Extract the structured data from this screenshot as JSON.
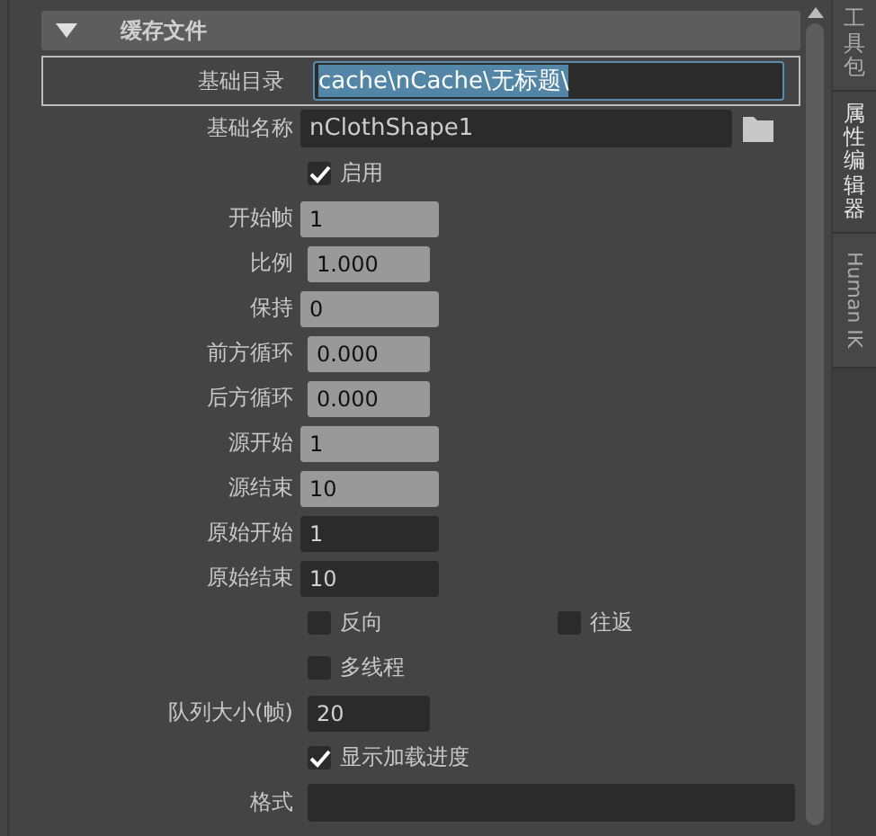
{
  "section": {
    "title": "缓存文件",
    "expanded": true
  },
  "base_dir": {
    "label": "基础目录",
    "value": "cache\\nCache\\无标题\\",
    "focused": true
  },
  "base_name": {
    "label": "基础名称",
    "value": "nClothShape1"
  },
  "rows": [
    {
      "kind": "checkbox",
      "label": "启用",
      "checked": true
    },
    {
      "kind": "int_field",
      "label": "开始帧",
      "value": "1",
      "editable": true
    },
    {
      "kind": "float_field",
      "label": "比例",
      "value": "1.000",
      "editable": true
    },
    {
      "kind": "int_field",
      "label": "保持",
      "value": "0",
      "editable": true
    },
    {
      "kind": "float_field",
      "label": "前方循环",
      "value": "0.000",
      "editable": true
    },
    {
      "kind": "float_field",
      "label": "后方循环",
      "value": "0.000",
      "editable": true
    },
    {
      "kind": "int_field",
      "label": "源开始",
      "value": "1",
      "editable": true
    },
    {
      "kind": "int_field",
      "label": "源结束",
      "value": "10",
      "editable": true
    },
    {
      "kind": "int_field",
      "label": "原始开始",
      "value": "1",
      "editable": false
    },
    {
      "kind": "int_field",
      "label": "原始结束",
      "value": "10",
      "editable": false
    },
    {
      "kind": "checkbox_pair",
      "items": [
        {
          "label": "反向",
          "checked": false
        },
        {
          "label": "往返",
          "checked": false
        }
      ]
    },
    {
      "kind": "checkbox",
      "label": "多线程",
      "checked": false
    },
    {
      "kind": "float_field",
      "label": "队列大小(帧)",
      "value": "20",
      "editable": false
    },
    {
      "kind": "checkbox",
      "label": "显示加载进度",
      "checked": true
    },
    {
      "kind": "wide_field",
      "label": "格式",
      "editable": false
    }
  ],
  "side_tabs": [
    {
      "label": "工具包",
      "kind": "stacked",
      "selected": false
    },
    {
      "label": "属性编辑器",
      "kind": "stacked",
      "selected": true
    },
    {
      "label": "Human IK",
      "kind": "rotated",
      "selected": false
    }
  ]
}
